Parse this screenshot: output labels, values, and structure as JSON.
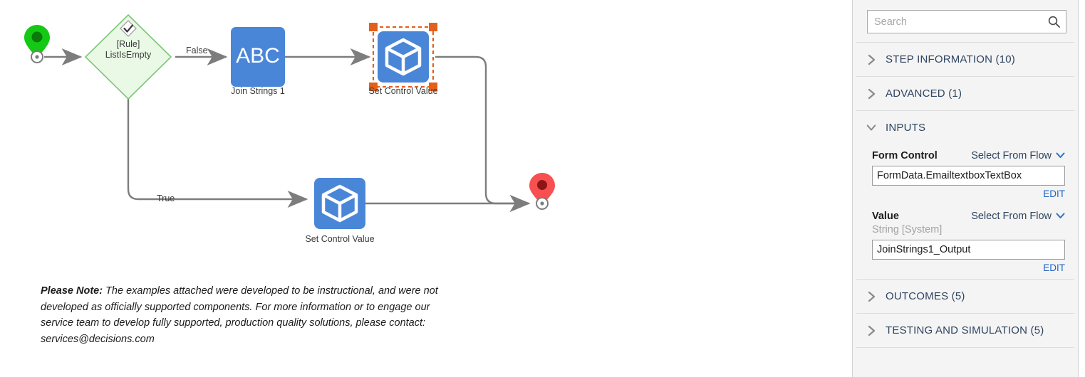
{
  "canvas": {
    "nodes": [
      {
        "id": "start",
        "type": "start-pin",
        "label": ""
      },
      {
        "id": "rule",
        "type": "rule-diamond",
        "label": "[Rule]\nListIsEmpty",
        "badge": "check-icon"
      },
      {
        "id": "join",
        "type": "abc-step",
        "label": "Join Strings 1",
        "glyph": "ABC"
      },
      {
        "id": "setctl1",
        "type": "cube-step",
        "label": "Set Control Value",
        "selected": true
      },
      {
        "id": "setctl2",
        "type": "cube-step",
        "label": "Set Control Value",
        "selected": false
      },
      {
        "id": "end",
        "type": "end-pin",
        "label": ""
      }
    ],
    "edges": [
      {
        "from": "rule",
        "to": "join",
        "label": "False"
      },
      {
        "from": "rule",
        "to": "setctl2",
        "label": "True"
      }
    ],
    "note": {
      "lead": "Please Note:",
      "body": " The examples attached were developed to be instructional, and were not developed as officially supported components. For more information or to engage our service team to develop fully supported, production quality solutions, please contact: services@decisions.com"
    },
    "colors": {
      "step_blue": "#4a86d8",
      "rule_green_fill": "#eaf8e6",
      "rule_green_stroke": "#7cc576",
      "start_green": "#14c914",
      "end_red": "#f85050",
      "edge_gray": "#7d7d7d",
      "selection_orange": "#e2601b"
    }
  },
  "panel": {
    "search": {
      "placeholder": "Search",
      "value": "",
      "icon": "search-icon"
    },
    "sections": [
      {
        "id": "step-information",
        "title": "STEP INFORMATION (10)",
        "expanded": false,
        "icon": "chevron-right-icon"
      },
      {
        "id": "advanced",
        "title": "ADVANCED (1)",
        "expanded": false,
        "icon": "chevron-right-icon"
      },
      {
        "id": "inputs",
        "title": "INPUTS",
        "expanded": true,
        "icon": "chevron-down-icon"
      },
      {
        "id": "outcomes",
        "title": "OUTCOMES (5)",
        "expanded": false,
        "icon": "chevron-right-icon"
      },
      {
        "id": "testing-simulation",
        "title": "TESTING AND SIMULATION (5)",
        "expanded": false,
        "icon": "chevron-right-icon"
      }
    ],
    "inputs": {
      "form_control": {
        "label": "Form Control",
        "source_label": "Select From Flow",
        "source_icon": "chevron-down-icon",
        "value": "FormData.EmailtextboxTextBox",
        "edit_label": "EDIT"
      },
      "value": {
        "label": "Value",
        "source_label": "Select From Flow",
        "source_icon": "chevron-down-icon",
        "type_hint": "String [System]",
        "value": "JoinStrings1_Output",
        "edit_label": "EDIT"
      }
    },
    "colors": {
      "bg": "#f4f4f4",
      "section_title": "#2e4460",
      "link_blue": "#1f63c4",
      "muted": "#a3a3a3"
    }
  }
}
